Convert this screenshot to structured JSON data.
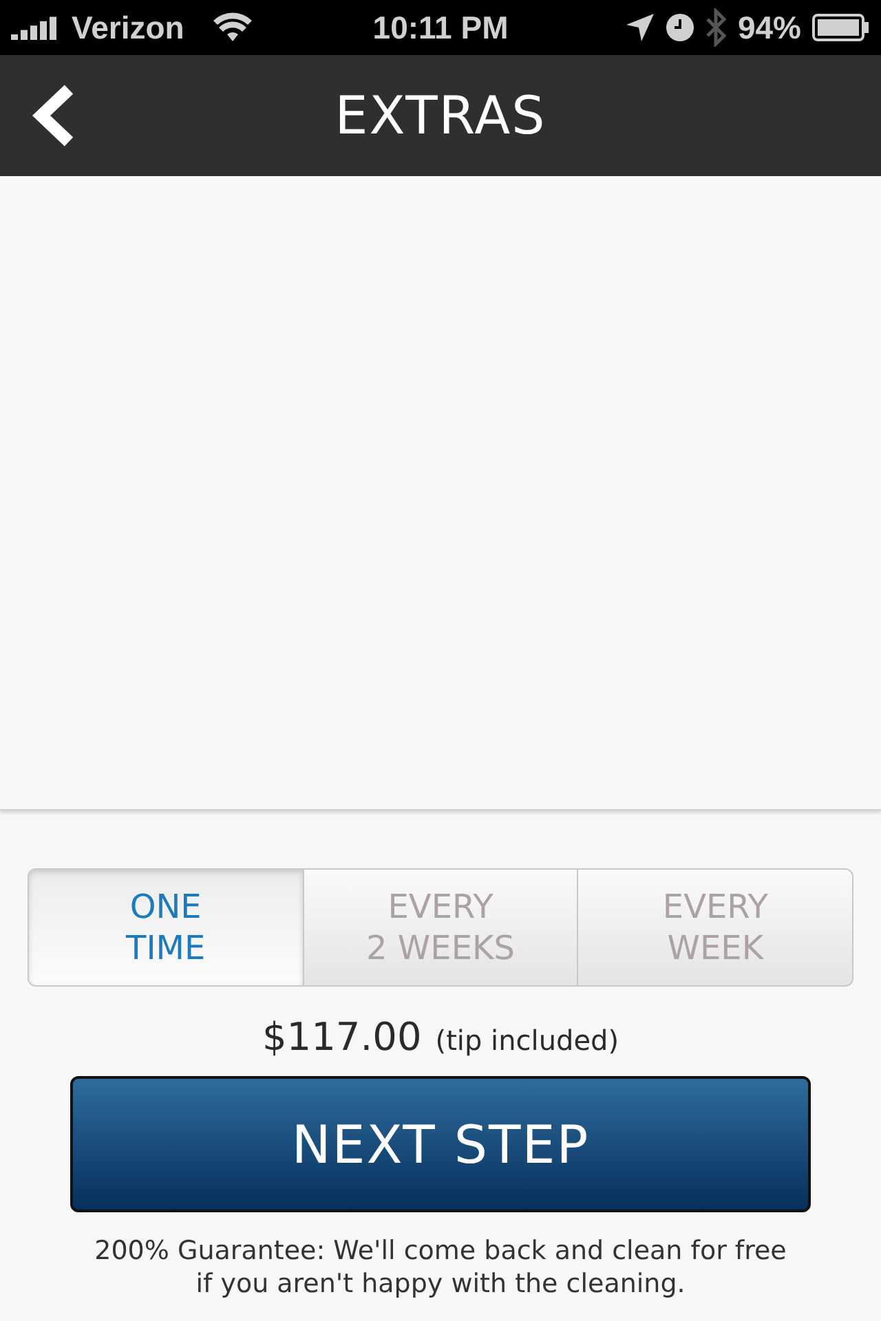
{
  "status_bar": {
    "carrier": "Verizon",
    "time": "10:11 PM",
    "battery": "94%"
  },
  "nav": {
    "title": "EXTRAS"
  },
  "frequency_tabs": [
    {
      "lines": [
        "ONE",
        "TIME"
      ],
      "selected": true
    },
    {
      "lines": [
        "EVERY",
        "2 WEEKS"
      ],
      "selected": false
    },
    {
      "lines": [
        "EVERY",
        "WEEK"
      ],
      "selected": false
    }
  ],
  "price": {
    "amount": "$117.00",
    "note": "(tip included)"
  },
  "next_button": "NEXT STEP",
  "guarantee": "200% Guarantee: We'll come back and clean for free if you aren't happy with the cleaning."
}
